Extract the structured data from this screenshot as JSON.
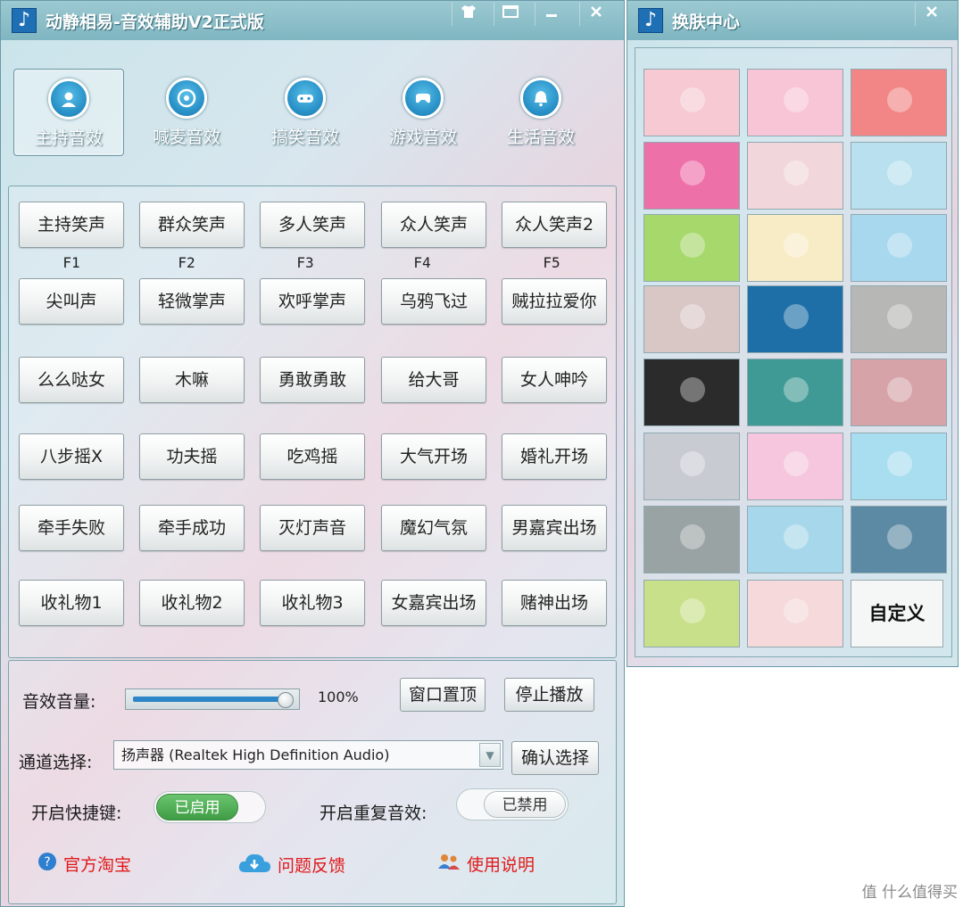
{
  "main_window": {
    "title": "动静相易-音效辅助V2正式版",
    "title_buttons": [
      "shirt",
      "window",
      "minimize",
      "close"
    ],
    "categories": [
      {
        "label": "主持音效",
        "icon": "person-icon",
        "active": true
      },
      {
        "label": "喊麦音效",
        "icon": "disc-icon",
        "active": false
      },
      {
        "label": "搞笑音效",
        "icon": "gamepad-icon",
        "active": false
      },
      {
        "label": "游戏音效",
        "icon": "controller-icon",
        "active": false
      },
      {
        "label": "生活音效",
        "icon": "bell-icon",
        "active": false
      }
    ],
    "sound_buttons": [
      [
        "主持笑声",
        "群众笑声",
        "多人笑声",
        "众人笑声",
        "众人笑声2"
      ],
      [
        "尖叫声",
        "轻微掌声",
        "欢呼掌声",
        "乌鸦飞过",
        "贼拉拉爱你"
      ],
      [
        "么么哒女",
        "木嘛",
        "勇敢勇敢",
        "给大哥",
        "女人呻吟"
      ],
      [
        "八步摇X",
        "功夫摇",
        "吃鸡摇",
        "大气开场",
        "婚礼开场"
      ],
      [
        "牵手失败",
        "牵手成功",
        "灭灯声音",
        "魔幻气氛",
        "男嘉宾出场"
      ],
      [
        "收礼物1",
        "收礼物2",
        "收礼物3",
        "女嘉宾出场",
        "赌神出场"
      ]
    ],
    "hotkeys": [
      "F1",
      "F2",
      "F3",
      "F4",
      "F5"
    ],
    "controls": {
      "volume_label": "音效音量:",
      "volume_percent": "100%",
      "volume_value": 1.0,
      "pin_button": "窗口置顶",
      "stop_button": "停止播放",
      "channel_label": "通道选择:",
      "channel_value": "扬声器 (Realtek High Definition Audio)",
      "confirm_button": "确认选择",
      "hotkey_label": "开启快捷键:",
      "hotkey_state": "已启用",
      "repeat_label": "开启重复音效:",
      "repeat_state": "已禁用"
    },
    "links": [
      {
        "label": "官方淘宝",
        "icon": "help-icon"
      },
      {
        "label": "问题反馈",
        "icon": "cloud-download-icon"
      },
      {
        "label": "使用说明",
        "icon": "users-icon"
      }
    ]
  },
  "skin_window": {
    "title": "换肤中心",
    "custom_label": "自定义",
    "thumbnails": [
      {
        "name": "pink-petals",
        "bg": "#f6c9d3"
      },
      {
        "name": "girl-pink",
        "bg": "#f7c5d6"
      },
      {
        "name": "red-plane",
        "bg": "#f28686"
      },
      {
        "name": "magenta-boy",
        "bg": "#ee70a9"
      },
      {
        "name": "cherry-branch",
        "bg": "#f1d7db"
      },
      {
        "name": "watermelon",
        "bg": "#b8e0ef"
      },
      {
        "name": "green-girl",
        "bg": "#a6d86b"
      },
      {
        "name": "taurus",
        "bg": "#f8ecc6"
      },
      {
        "name": "aquarius",
        "bg": "#a8d8ee"
      },
      {
        "name": "blossom-blur",
        "bg": "#d9c7c6"
      },
      {
        "name": "blue-text",
        "bg": "#1e6fa8"
      },
      {
        "name": "grey-writing",
        "bg": "#b7b7b5"
      },
      {
        "name": "dark-ring",
        "bg": "#2b2b2b"
      },
      {
        "name": "teal-text",
        "bg": "#3f9a95"
      },
      {
        "name": "red-blur",
        "bg": "#d6a3a8"
      },
      {
        "name": "sakura-tree",
        "bg": "#c9cbd3"
      },
      {
        "name": "pink-toy",
        "bg": "#f5c6dd"
      },
      {
        "name": "blue-girl",
        "bg": "#a9def0"
      },
      {
        "name": "grey-dolls",
        "bg": "#9aa3a3"
      },
      {
        "name": "hand-heart",
        "bg": "#a6d7ea"
      },
      {
        "name": "sea-figure",
        "bg": "#5c8aa4"
      },
      {
        "name": "green-leaves",
        "bg": "#c9e08a"
      },
      {
        "name": "heart-girl",
        "bg": "#f5d9db"
      }
    ]
  },
  "watermark": "值 什么值得买"
}
